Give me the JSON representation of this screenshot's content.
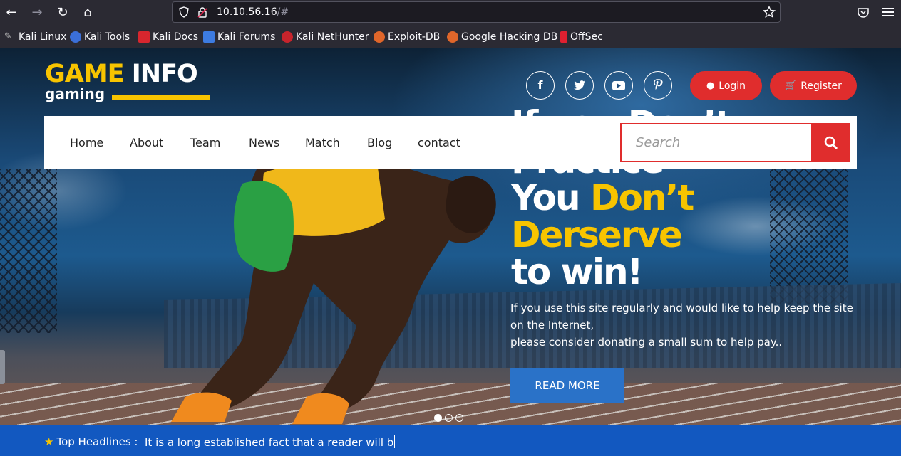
{
  "browser": {
    "url_main": "10.10.56.16",
    "url_suffix": "/#",
    "bookmarks": [
      "Kali Linux",
      "Kali Tools",
      "Kali Docs",
      "Kali Forums",
      "Kali NetHunter",
      "Exploit-DB",
      "Google Hacking DB",
      "OffSec"
    ]
  },
  "logo": {
    "word1": "GAME",
    "word2": "INFO",
    "sub": "gaming"
  },
  "header": {
    "social": [
      "f",
      "t",
      "▶",
      "p"
    ],
    "login_label": "Login",
    "register_label": "Register"
  },
  "nav": {
    "items": [
      "Home",
      "About",
      "Team",
      "News",
      "Match",
      "Blog",
      "contact"
    ],
    "search_placeholder": "Search"
  },
  "hero": {
    "line1": "If you Don’t",
    "line2": "Practice",
    "line3a": "You ",
    "line3b": "Don’t",
    "line4": "Derserve",
    "line5": "to win!",
    "blurb1": "If you use this site regularly and would like to help keep the site",
    "blurb2": "on the Internet,",
    "blurb3": "please consider donating a small sum to help pay..",
    "cta": "READ MORE",
    "slides": 3,
    "active_slide": 1
  },
  "ticker": {
    "label": "Top Headlines :",
    "text": "It is a long established fact that a reader will b"
  },
  "colors": {
    "brand_yellow": "#f7c400",
    "accent_red": "#e02d2d",
    "ticker_blue": "#1258c0",
    "cta_blue": "#2a72c8"
  }
}
